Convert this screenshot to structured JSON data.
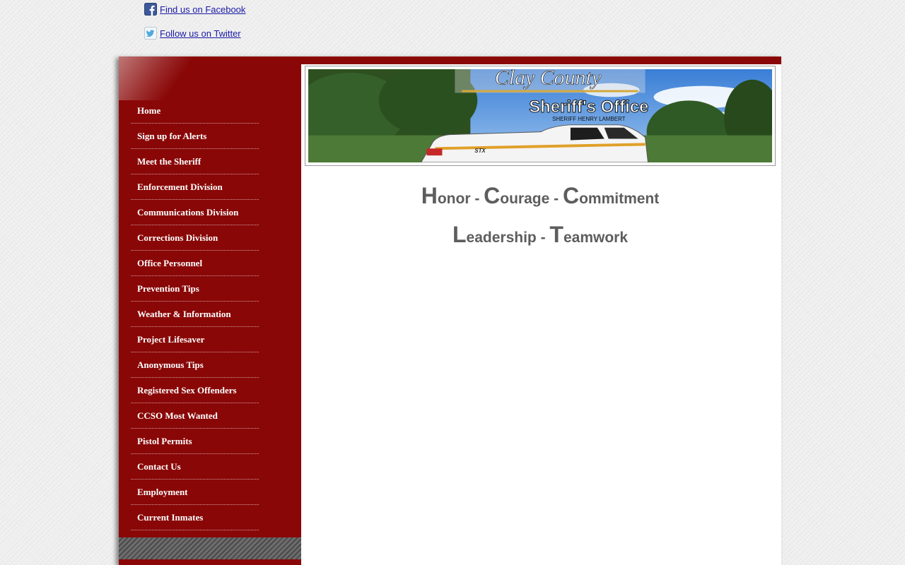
{
  "social": {
    "facebook_label": "Find us on Facebook",
    "twitter_label": "Follow us on Twitter"
  },
  "banner": {
    "title": "Clay County",
    "subtitle": "Sheriff's Office",
    "sheriff": "SHERIFF HENRY LAMBERT",
    "truck_badge": "STX"
  },
  "nav": [
    {
      "label": "Home"
    },
    {
      "label": "Sign up for Alerts"
    },
    {
      "label": "Meet the Sheriff"
    },
    {
      "label": "Enforcement Division"
    },
    {
      "label": "Communications Division"
    },
    {
      "label": "Corrections Division"
    },
    {
      "label": "Office Personnel"
    },
    {
      "label": "Prevention Tips"
    },
    {
      "label": "Weather & Information"
    },
    {
      "label": "Project Lifesaver"
    },
    {
      "label": "Anonymous Tips"
    },
    {
      "label": "Registered Sex Offenders"
    },
    {
      "label": "CCSO Most Wanted"
    },
    {
      "label": "Pistol Permits"
    },
    {
      "label": "Contact Us"
    },
    {
      "label": "Employment"
    },
    {
      "label": "Current Inmates"
    }
  ],
  "motto": {
    "line1": [
      {
        "initial": "H",
        "rest": "onor"
      },
      {
        "initial": "C",
        "rest": "ourage"
      },
      {
        "initial": "C",
        "rest": "ommitment"
      }
    ],
    "line2": [
      {
        "initial": "L",
        "rest": "eadership"
      },
      {
        "initial": "T",
        "rest": "eamwork"
      }
    ],
    "separator": " - "
  },
  "colors": {
    "sidebar": "#8a0707",
    "link": "#1a1aa6",
    "motto_text": "#5d5d5d"
  }
}
